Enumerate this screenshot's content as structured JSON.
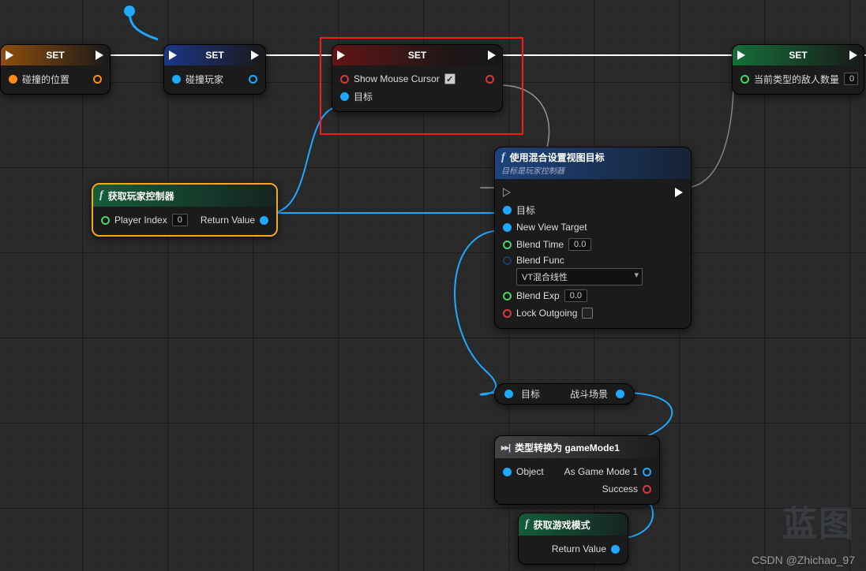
{
  "nodes": {
    "set1": {
      "title": "SET",
      "var": "碰撞的位置"
    },
    "set2": {
      "title": "SET",
      "var": "碰撞玩家"
    },
    "set3": {
      "title": "SET",
      "var": "Show Mouse Cursor",
      "target": "目标"
    },
    "set4": {
      "title": "SET",
      "var": "当前类型的敌人数量",
      "val": "0"
    },
    "getpc": {
      "title": "获取玩家控制器",
      "p_index": "Player Index",
      "p_index_val": "0",
      "retval": "Return Value"
    },
    "blend": {
      "title": "使用混合设置视图目标",
      "subtitle": "目标是玩家控制器",
      "p_target": "目标",
      "p_newview": "New View Target",
      "p_blendtime": "Blend Time",
      "blendtime_val": "0.0",
      "p_blendfunc": "Blend Func",
      "blendfunc_val": "VT混合线性",
      "p_blendexp": "Blend Exp",
      "blendexp_val": "0.0",
      "p_lock": "Lock Outgoing"
    },
    "targetpill": {
      "l": "目标",
      "r": "战斗场景"
    },
    "cast": {
      "title": "类型转换为 gameMode1",
      "p_obj": "Object",
      "out1": "As Game Mode 1",
      "out2": "Success"
    },
    "getgm": {
      "title": "获取游戏模式",
      "retval": "Return Value"
    }
  },
  "watermark": "蓝图",
  "credit": "CSDN @Zhichao_97"
}
